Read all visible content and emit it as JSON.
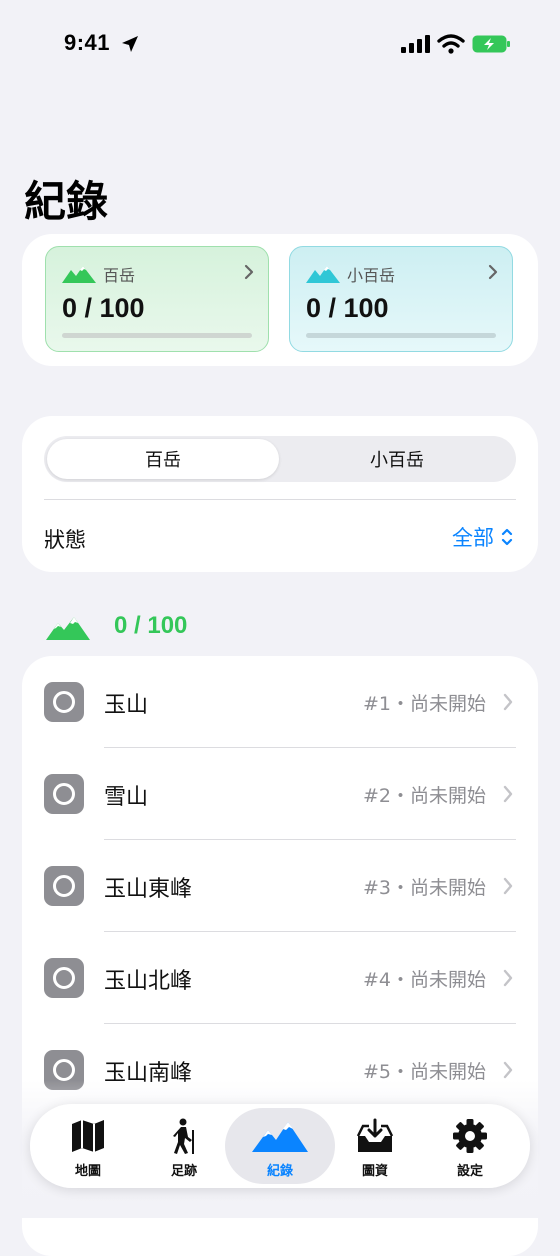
{
  "status_bar": {
    "time": "9:41"
  },
  "page": {
    "title": "紀錄"
  },
  "summary": {
    "tiles": [
      {
        "label": "百岳",
        "value": "0 / 100",
        "progress": 0
      },
      {
        "label": "小百岳",
        "value": "0 / 100",
        "progress": 0
      }
    ]
  },
  "filter": {
    "segments": [
      "百岳",
      "小百岳"
    ],
    "selected_segment": "百岳",
    "status_label": "狀態",
    "status_value": "全部"
  },
  "section": {
    "count": "0 / 100"
  },
  "mountains": [
    {
      "name": "玉山",
      "meta": "#1・尚未開始"
    },
    {
      "name": "雪山",
      "meta": "#2・尚未開始"
    },
    {
      "name": "玉山東峰",
      "meta": "#3・尚未開始"
    },
    {
      "name": "玉山北峰",
      "meta": "#4・尚未開始"
    },
    {
      "name": "玉山南峰",
      "meta": "#5・尚未開始"
    }
  ],
  "tabbar": {
    "active": "紀錄",
    "tabs": [
      {
        "label": "地圖",
        "icon": "map-icon"
      },
      {
        "label": "足跡",
        "icon": "hiker-icon"
      },
      {
        "label": "紀錄",
        "icon": "mountains-icon"
      },
      {
        "label": "圖資",
        "icon": "download-tray-icon"
      },
      {
        "label": "設定",
        "icon": "gear-icon"
      }
    ]
  },
  "colors": {
    "accent": "#0a84ff",
    "green": "#34c759",
    "teal": "#30c7d6",
    "gray_icon": "#8e8e93"
  }
}
